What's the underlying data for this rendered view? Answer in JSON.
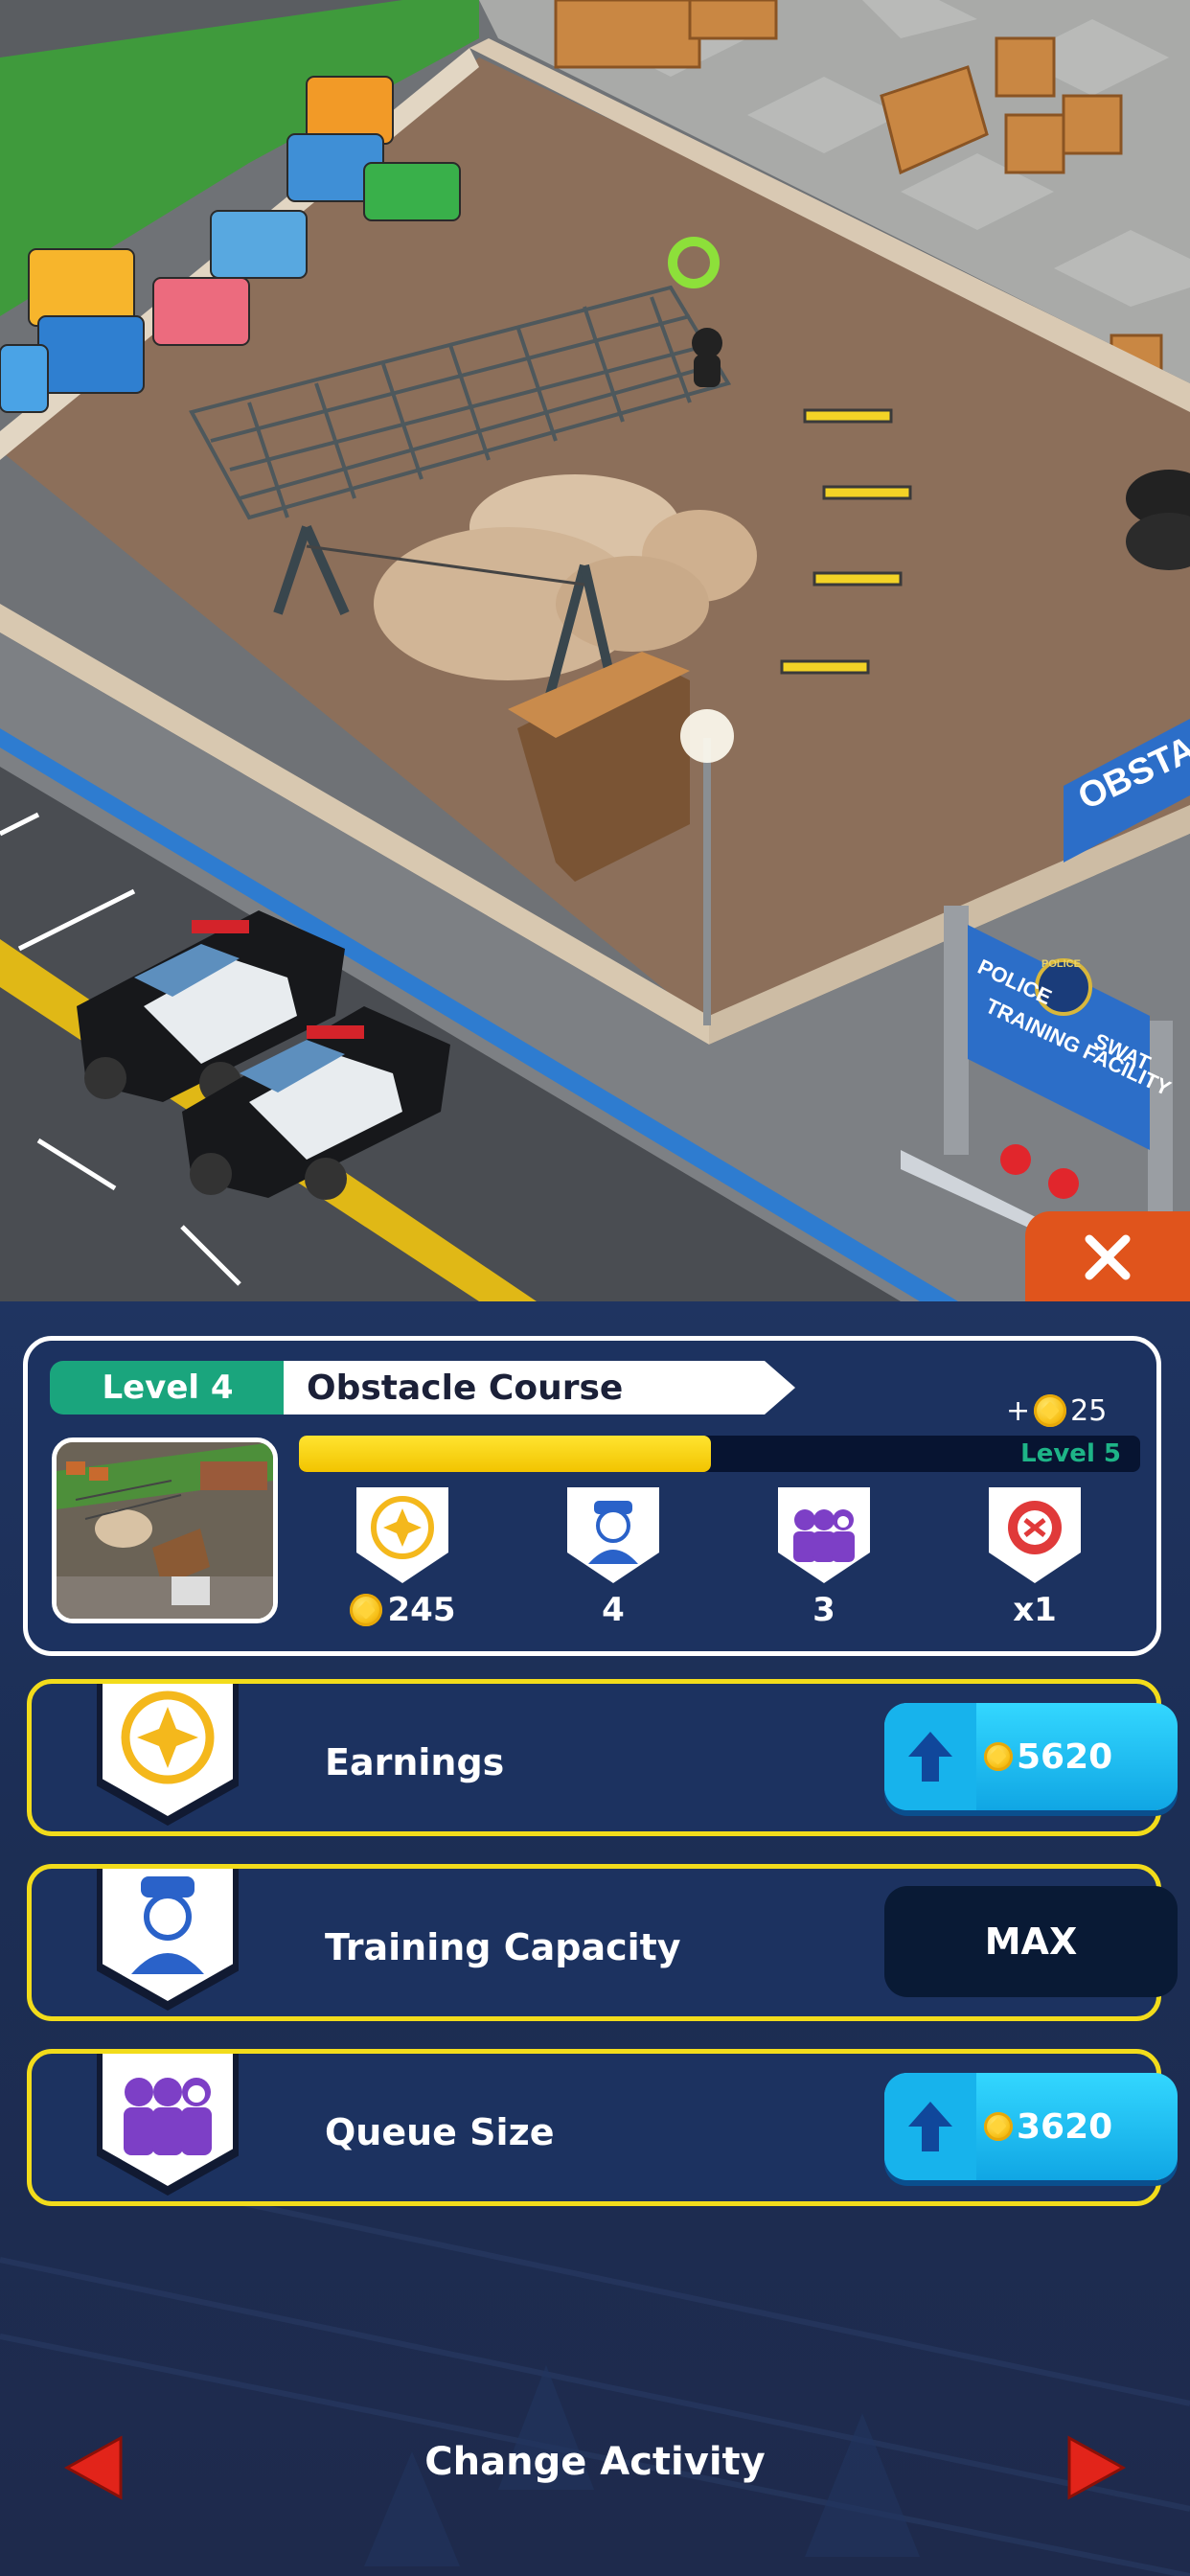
{
  "scene": {
    "sign_top": "OBSTA",
    "sign_police": "POLICE",
    "sign_line1": "POLICE",
    "sign_line2": "SWAT",
    "sign_line3": "TRAINING FACILITY"
  },
  "close": {
    "icon": "close-icon"
  },
  "header": {
    "level_label": "Level 4",
    "activity_name": "Obstacle Course",
    "reward_prefix": "+",
    "reward_amount": "25",
    "progress": 0.49,
    "next_level_label": "Level 5"
  },
  "stats": [
    {
      "icon": "coin-badge-icon",
      "value": "245",
      "with_coin": true
    },
    {
      "icon": "trainee-icon",
      "value": "4",
      "with_coin": false
    },
    {
      "icon": "trainee-group-icon",
      "value": "3",
      "with_coin": false
    },
    {
      "icon": "speed-multiplier-icon",
      "value": "x1",
      "with_coin": false
    }
  ],
  "upgrades": [
    {
      "label": "Earnings",
      "icon": "coin-badge-icon",
      "state": "buy",
      "price": "5620"
    },
    {
      "label": "Training Capacity",
      "icon": "trainee-icon",
      "state": "max",
      "status": "MAX"
    },
    {
      "label": "Queue Size",
      "icon": "trainee-group-icon",
      "state": "buy",
      "price": "3620"
    }
  ],
  "footer": {
    "change_activity": "Change Activity"
  },
  "colors": {
    "accent_orange": "#e0541c",
    "level_green": "#1aa57d",
    "progress_yellow": "#f2c400",
    "row_border": "#f2dc1b",
    "buy_blue": "#1ab8ef",
    "panel_navy": "#1c3260",
    "nav_red": "#e2241a"
  }
}
